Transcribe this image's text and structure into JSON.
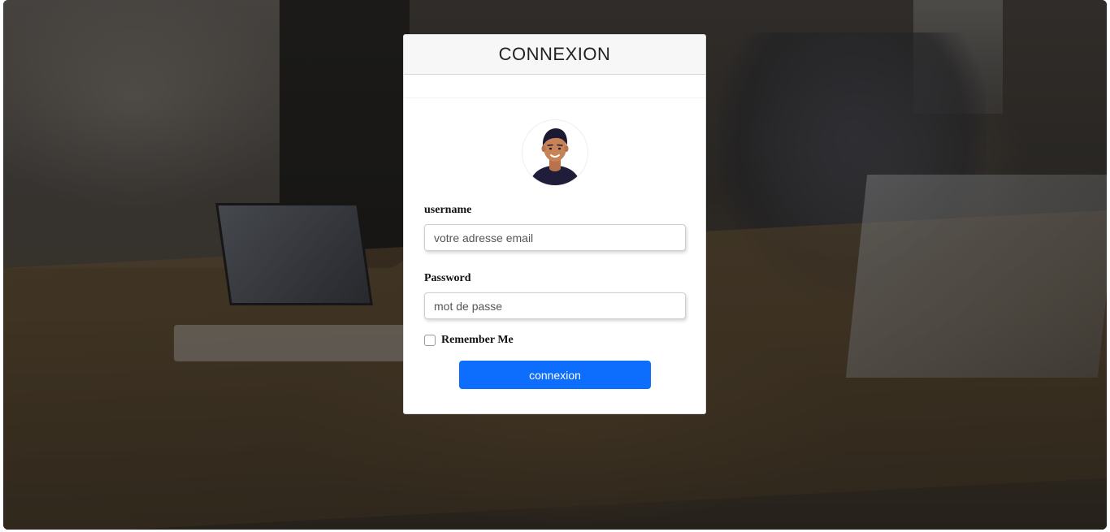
{
  "login": {
    "title": "CONNEXION",
    "username_label": "username",
    "username_placeholder": "votre adresse email",
    "username_value": "",
    "password_label": "Password",
    "password_placeholder": "mot de passe",
    "password_value": "",
    "remember_label": "Remember Me",
    "remember_checked": false,
    "submit_label": "connexion"
  },
  "icons": {
    "avatar": "user-avatar-icon"
  },
  "colors": {
    "primary_button": "#0d6efd",
    "header_background": "#f7f7f7",
    "card_background": "#ffffff"
  }
}
